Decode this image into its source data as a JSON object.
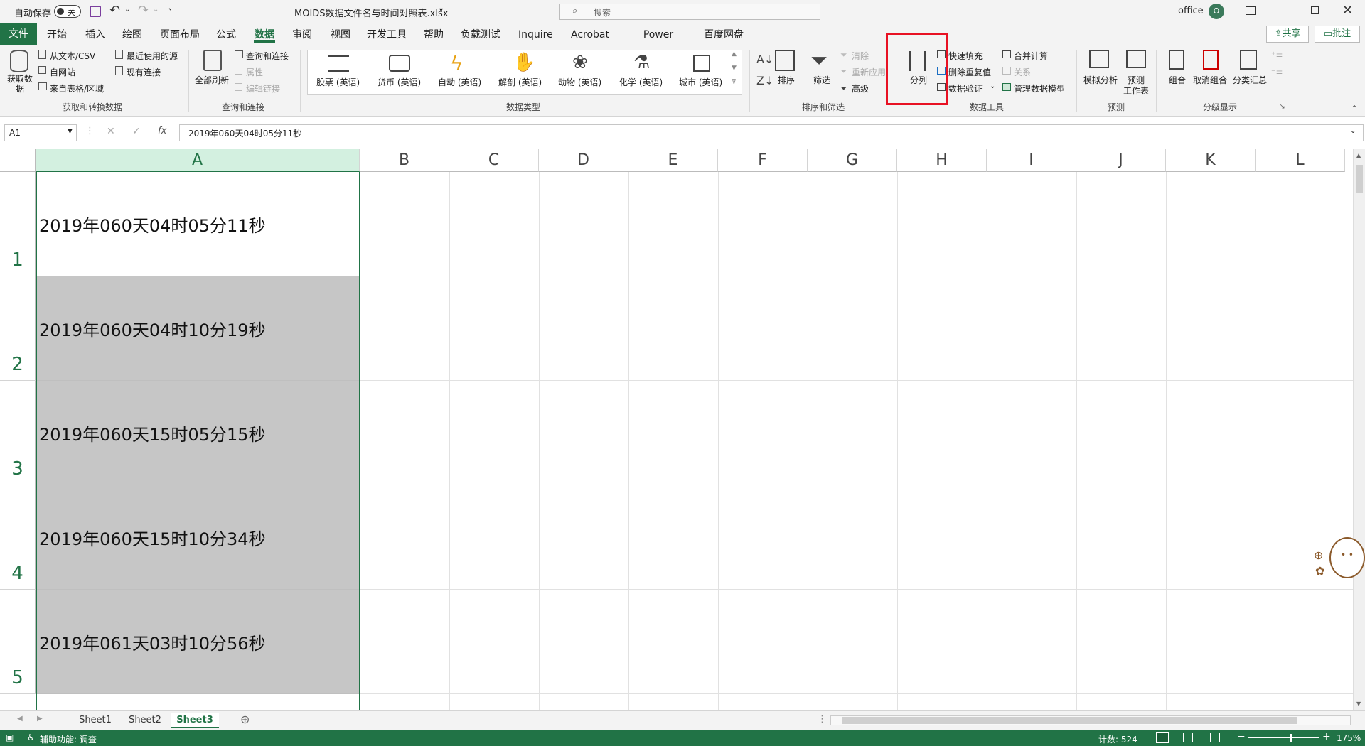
{
  "titlebar": {
    "autosave_label": "自动保存",
    "autosave_state": "关",
    "filename": "MOIDS数据文件名与时间对照表.xlsx",
    "search_placeholder": "搜索",
    "user_name": "office",
    "user_initial": "O"
  },
  "menubar": {
    "file": "文件",
    "tabs": [
      "开始",
      "插入",
      "绘图",
      "页面布局",
      "公式",
      "数据",
      "审阅",
      "视图",
      "开发工具",
      "帮助",
      "负载测试",
      "Inquire",
      "Acrobat",
      "Power Pivot",
      "百度网盘"
    ],
    "active_tab": "数据",
    "share": "共享",
    "comments": "批注"
  },
  "ribbon": {
    "get_data": {
      "big": "获取数\n据",
      "items": [
        "从文本/CSV",
        "自网站",
        "来自表格/区域",
        "最近使用的源",
        "现有连接"
      ],
      "group": "获取和转换数据"
    },
    "queries": {
      "big": "全部刷新",
      "items": [
        "查询和连接",
        "属性",
        "编辑链接"
      ],
      "group": "查询和连接"
    },
    "data_types": {
      "items": [
        "股票 (英语)",
        "货币 (英语)",
        "自动 (英语)",
        "解剖 (英语)",
        "动物 (英语)",
        "化学 (英语)",
        "城市 (英语)"
      ],
      "group": "数据类型"
    },
    "sort_filter": {
      "sort": "排序",
      "filter": "筛选",
      "clear": "清除",
      "reapply": "重新应用",
      "advanced": "高级",
      "group": "排序和筛选"
    },
    "data_tools": {
      "text_to_columns": "分列",
      "flash_fill": "快速填充",
      "remove_duplicates": "删除重复值",
      "validation": "数据验证",
      "consolidate": "合并计算",
      "relationships": "关系",
      "data_model": "管理数据模型",
      "group": "数据工具"
    },
    "forecast": {
      "what_if": "模拟分析",
      "forecast_sheet_1": "预测",
      "forecast_sheet_2": "工作表",
      "group": "预测"
    },
    "outline": {
      "group_btn": "组合",
      "ungroup": "取消组合",
      "subtotal": "分类汇总",
      "group": "分级显示"
    }
  },
  "formulabar": {
    "name_box": "A1",
    "fx": "fx",
    "content": "2019年060天04时05分11秒"
  },
  "grid": {
    "columns": [
      "A",
      "B",
      "C",
      "D",
      "E",
      "F",
      "G",
      "H",
      "I",
      "J",
      "K",
      "L"
    ],
    "rows": [
      {
        "num": "1",
        "a": "2019年060天04时05分11秒"
      },
      {
        "num": "2",
        "a": "2019年060天04时10分19秒"
      },
      {
        "num": "3",
        "a": "2019年060天15时05分15秒"
      },
      {
        "num": "4",
        "a": "2019年060天15时10分34秒"
      },
      {
        "num": "5",
        "a": "2019年061天03时10分56秒"
      }
    ]
  },
  "sheets": {
    "tabs": [
      "Sheet1",
      "Sheet2",
      "Sheet3"
    ],
    "active": "Sheet3"
  },
  "statusbar": {
    "accessibility": "辅助功能: 调查",
    "count": "计数: 524",
    "zoom": "175%"
  },
  "colors": {
    "accent": "#217346",
    "highlight": "#e81123",
    "selection_fill": "#c6c6c6"
  }
}
